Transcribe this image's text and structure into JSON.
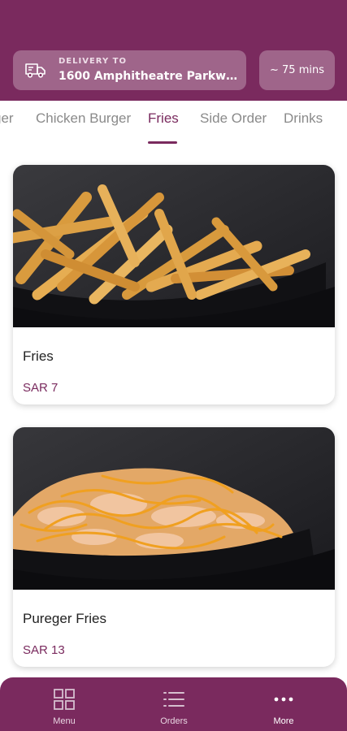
{
  "header": {
    "delivery_label": "DELIVERY TO",
    "delivery_address": "1600 Amphitheatre Parkwa...",
    "eta": "~ 75 mins",
    "icons": {
      "delivery": "truck-icon"
    }
  },
  "tabs": {
    "items": [
      {
        "label": "ger"
      },
      {
        "label": "Chicken Burger"
      },
      {
        "label": "Fries"
      },
      {
        "label": "Side Order"
      },
      {
        "label": "Drinks"
      }
    ],
    "active": "Fries"
  },
  "products": [
    {
      "name": "Fries",
      "price": "SAR 7",
      "image": "fries-photo"
    },
    {
      "name": "Pureger Fries",
      "price": "SAR 13",
      "image": "cheese-fries-photo"
    }
  ],
  "bottom_nav": {
    "items": [
      {
        "label": "Menu",
        "icon": "grid-icon"
      },
      {
        "label": "Orders",
        "icon": "list-icon"
      },
      {
        "label": "More",
        "icon": "more-dots-icon"
      }
    ]
  },
  "colors": {
    "brand": "#7a2a5e",
    "tab_inactive": "#8a8a8a",
    "background": "#ffffff"
  }
}
